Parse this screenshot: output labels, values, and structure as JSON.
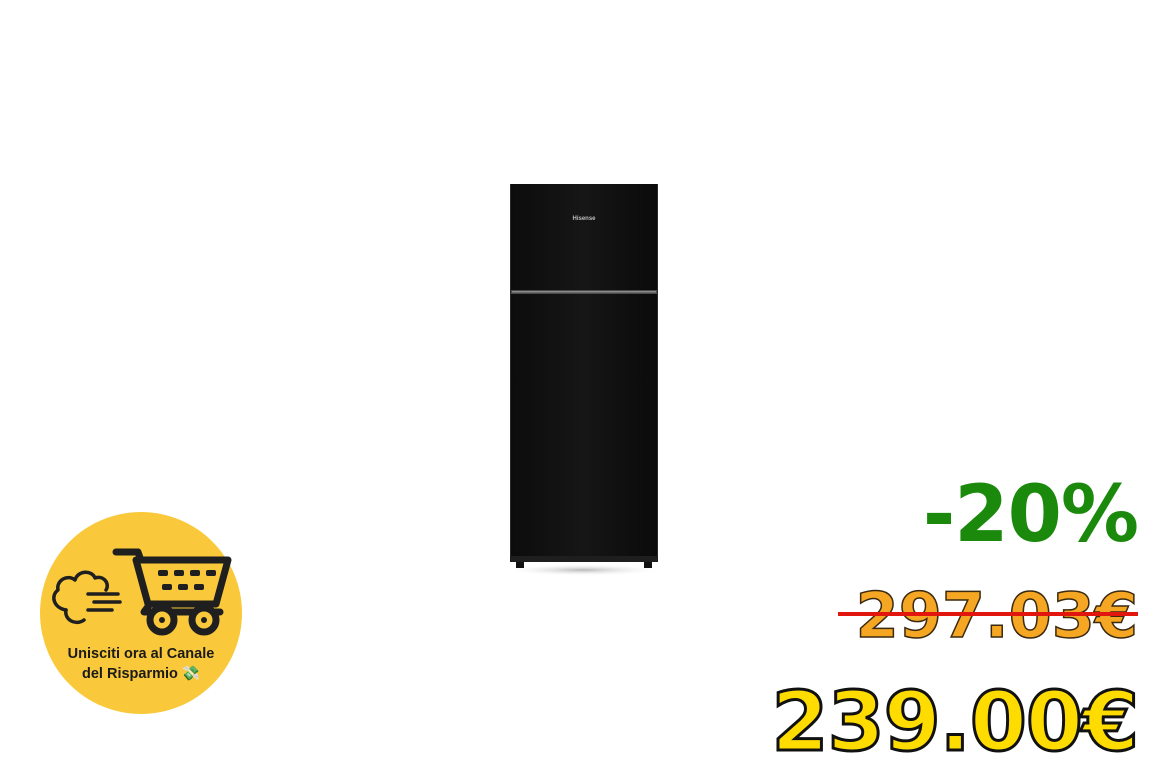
{
  "product": {
    "brand_text": "Hisense",
    "icon": "fridge-icon"
  },
  "promo": {
    "line1": "Unisciti ora al Canale",
    "line2": "del Risparmio 💸",
    "icon": "shopping-cart-icon",
    "badge_color": "#f9c93b"
  },
  "pricing": {
    "discount": "-20%",
    "old_price": "297.03€",
    "new_price": "239.00€",
    "colors": {
      "discount": "#1b8a0c",
      "old_price": "#f5a623",
      "strike": "#e0160f",
      "new_price": "#ffdc00"
    }
  }
}
